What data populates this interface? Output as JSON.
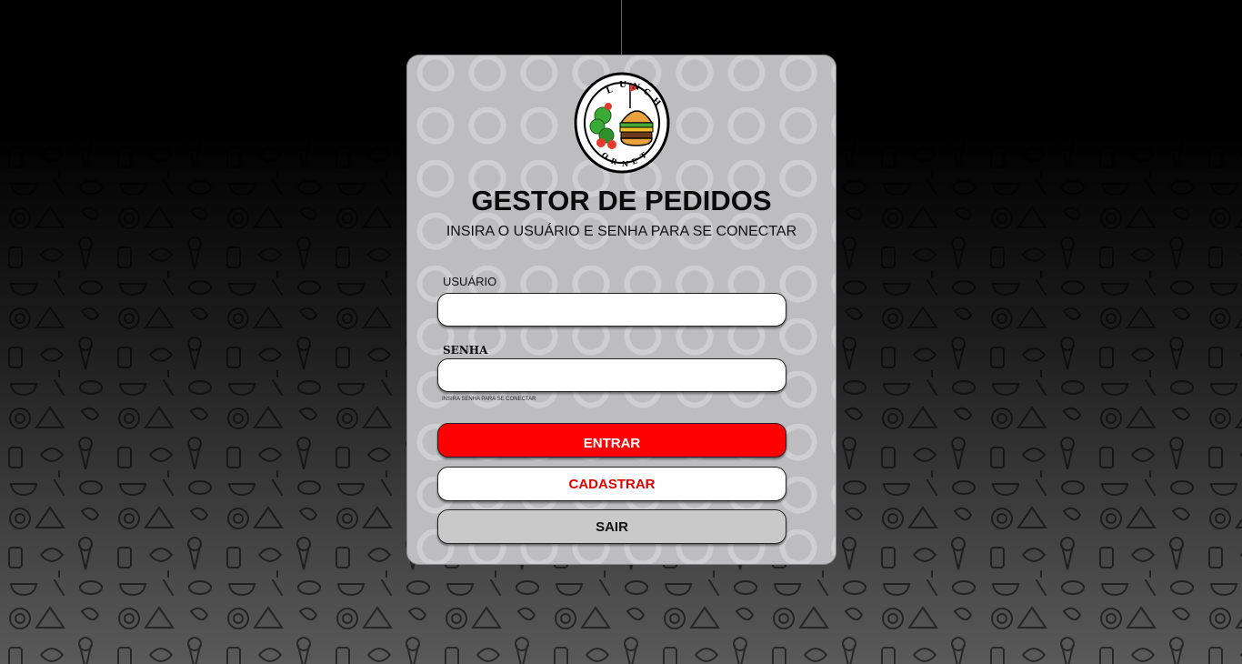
{
  "header": {
    "title": "GESTOR DE PEDIDOS",
    "subtitle": "INSIRA O USUÁRIO E SENHA PARA SE CONECTAR"
  },
  "logo": {
    "icon": "lunch-or-net-logo",
    "top_text": "LUNCH",
    "bottom_text": "OR NET"
  },
  "form": {
    "user_label": "USUÁRIO",
    "user_value": "",
    "password_label": "SENHA",
    "password_value": "",
    "password_hint": "INSIRA SENHA PARA SE CONECTAR"
  },
  "actions": {
    "login_label": "ENTRAR",
    "signup_label": "CADASTRAR",
    "exit_label": "SAIR"
  },
  "colors": {
    "primary": "#ff0000",
    "card_background": "#bdbdbf",
    "page_background": "#000000"
  }
}
